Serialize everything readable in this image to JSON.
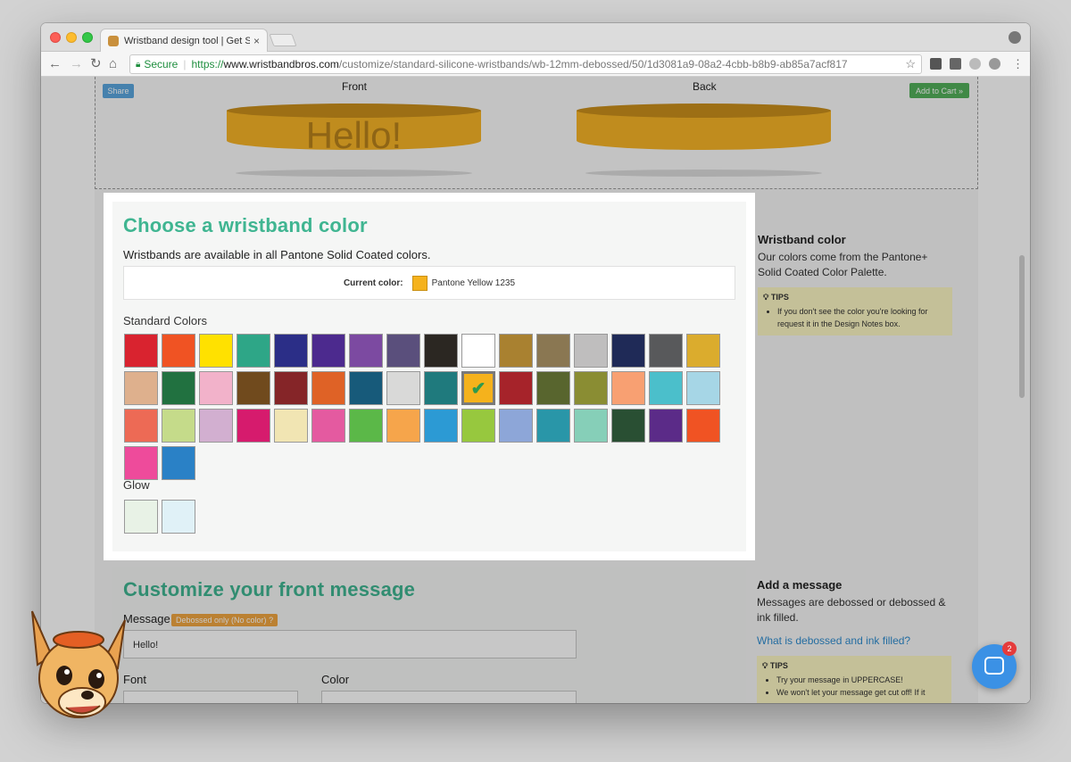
{
  "browser": {
    "tab_title": "Wristband design tool | Get St",
    "tab_close": "×",
    "address": {
      "secure_label": "Secure",
      "scheme": "https://",
      "host": "www.wristbandbros.com",
      "path": "/customize/standard-silicone-wristbands/wb-12mm-debossed/50/1d3081a9-08a2-4cbb-b8b9-ab85a7acf817"
    }
  },
  "preview": {
    "share_label": "Share",
    "cart_label": "Add to Cart »",
    "front_label": "Front",
    "back_label": "Back",
    "front_message": "Hello!"
  },
  "color_section": {
    "heading": "Choose a wristband color",
    "subheading": "Wristbands are available in all Pantone Solid Coated colors.",
    "current_label": "Current color:",
    "current_value": "Pantone Yellow 1235",
    "current_hex": "#f5b21c",
    "standard_label": "Standard Colors",
    "glow_label": "Glow",
    "selected_index": 25,
    "standard_colors": [
      "#d9232f",
      "#f05323",
      "#ffe100",
      "#2ea687",
      "#2b2e87",
      "#4c2a8e",
      "#7c4aa1",
      "#5a4f7c",
      "#2b2722",
      "#ffffff",
      "#a98130",
      "#8a7752",
      "#bfbebe",
      "#1f2a57",
      "#58595b",
      "#dbac2d",
      "#deb08d",
      "#217140",
      "#f2b2ca",
      "#704a1d",
      "#852528",
      "#df6226",
      "#175a7a",
      "#d9d9d8",
      "#1f7a7d",
      "#f5b21c",
      "#a6232a",
      "#58652e",
      "#8a8d33",
      "#f8a072",
      "#4bbfcb",
      "#a6d6e6",
      "#ed6a55",
      "#c5db8a",
      "#d2afd0",
      "#d61b6d",
      "#f1e5b3",
      "#e45aa0",
      "#5bb848",
      "#f6a54b",
      "#2c9ad4",
      "#97c83e",
      "#8da6d8",
      "#2996a8",
      "#86cfb8",
      "#294f33",
      "#5b2b88",
      "#f05323",
      "#ee4b9b",
      "#2a81c6"
    ],
    "glow_colors": [
      "#e8f2e6",
      "#e0f1f7"
    ]
  },
  "aside_color": {
    "title": "Wristband color",
    "text": "Our colors come from the Pantone+ Solid Coated Color Palette.",
    "tips_head": "TIPS",
    "tips": [
      "If you don't see the color you're looking for request it in the Design Notes box."
    ]
  },
  "front_section": {
    "heading": "Customize your front message",
    "message_label": "Message",
    "badge": "Debossed only (No color)",
    "message_value": "Hello!",
    "font_label": "Font",
    "color_label": "Color"
  },
  "aside_message": {
    "title": "Add a message",
    "text": "Messages are debossed or debossed & ink filled.",
    "link": "What is debossed and ink filled?",
    "tips_head": "TIPS",
    "tips": [
      "Try your message in UPPERCASE!",
      "We won't let your message get cut off! If it"
    ]
  },
  "chat": {
    "badge_count": "2"
  }
}
